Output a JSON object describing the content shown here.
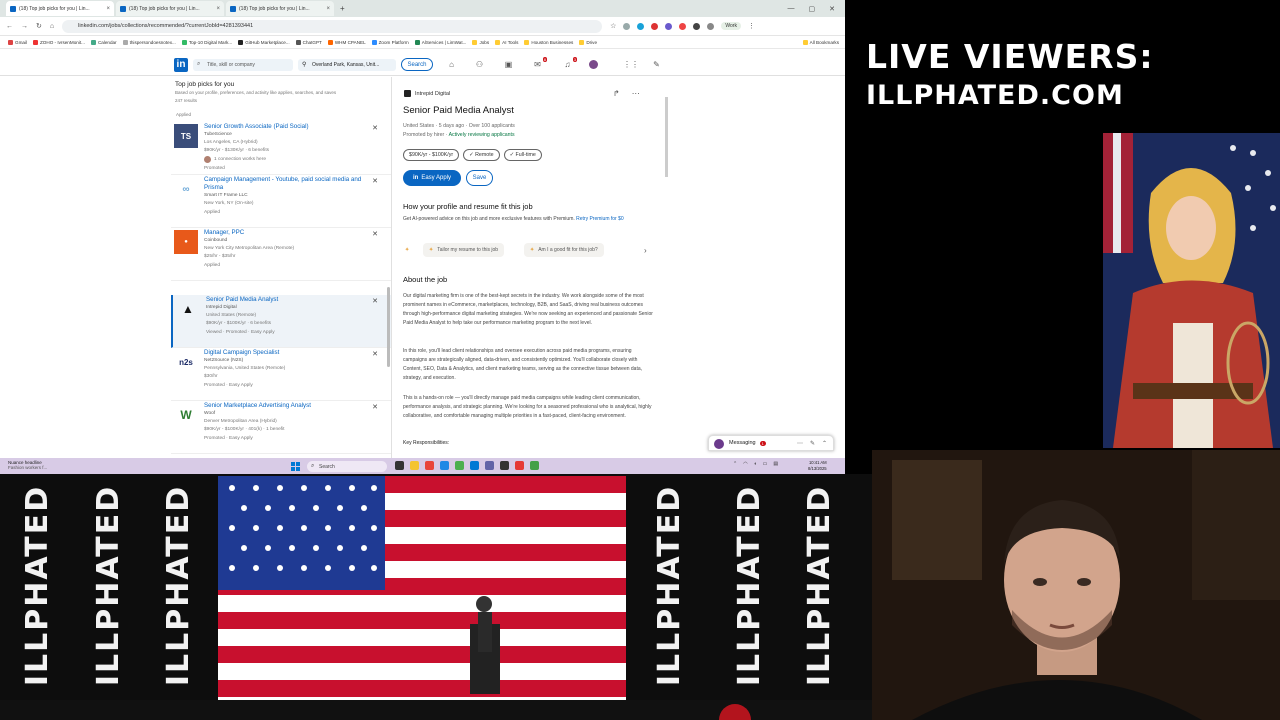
{
  "browser": {
    "tabs": [
      {
        "label": "(18) Top job picks for you | Lin..."
      },
      {
        "label": "(18) Top job picks for you | Lin..."
      },
      {
        "label": "(18) Top job picks for you | Lin..."
      }
    ],
    "url": "linkedin.com/jobs/collections/recommended/?currentJobId=4281393441",
    "profile_label": "Work",
    "bookmarks": [
      "Gmail",
      "ZOHO - IvrsenMonit...",
      "Calendar",
      "thispersondoesnotex...",
      "Top-10 Digital Mark...",
      "GitHub Marketplace...",
      "ChatGPT",
      "WHM CPANEL",
      "Zoom Platform",
      "AlServices | LimWat...",
      "Jobs",
      "AI Tools",
      "Houston Businesses",
      "Drive",
      "All Bookmarks"
    ]
  },
  "linkedin": {
    "search_placeholder": "Title, skill or company",
    "location_value": "Overland Park, Kansas, Unit...",
    "search_label": "Search",
    "nav_badges": [
      "",
      "8",
      "3",
      "2"
    ]
  },
  "job_list": {
    "title": "Top job picks for you",
    "subtitle": "Based on your profile, preferences, and activity like applies, searches, and saves",
    "count": "247 results",
    "top_status": "Applied",
    "cards": [
      {
        "logo": "TS",
        "logo_color": "#3a4d7a",
        "title": "Senior Growth Associate (Paid Social)",
        "company": "TubeScience",
        "location": "Los Angeles, CA (Hybrid)",
        "salary": "$90K/yr - $130K/yr · 6 benefits",
        "extra": "1 connection works here",
        "status": "Promoted"
      },
      {
        "logo": "∞",
        "logo_color": "#9ec6e6",
        "title": "Campaign Management - Youtube, paid social media and Prisma",
        "company": "Smart IT Frame LLC",
        "location": "New York, NY (On-site)",
        "salary": "",
        "extra": "",
        "status": "Applied"
      },
      {
        "logo": "●",
        "logo_color": "#e8591a",
        "title": "Manager, PPC",
        "company": "Coinbound",
        "location": "New York City Metropolitan Area (Remote)",
        "salary": "$25/hr - $35/hr",
        "extra": "",
        "status": "Applied"
      },
      {
        "logo": "▲",
        "logo_color": "#ffffff",
        "title": "Senior Paid Media Analyst",
        "company": "Intrepid Digital",
        "location": "United States (Remote)",
        "salary": "$90K/yr - $100K/yr · 6 benefits",
        "extra": "",
        "status": "Viewed · Promoted · Easy Apply"
      },
      {
        "logo": "n2s",
        "logo_color": "#ffffff",
        "title": "Digital Campaign Specialist",
        "company": "Net2Source (N2S)",
        "location": "Pennsylvania, United States (Remote)",
        "salary": "$30/hr",
        "extra": "",
        "status": "Promoted · Easy Apply"
      },
      {
        "logo": "W",
        "logo_color": "#ffffff",
        "title": "Senior Marketplace Advertising Analyst",
        "company": "Woof",
        "location": "Denver Metropolitan Area (Hybrid)",
        "salary": "$90K/yr - $100K/yr · 401(k) · 1 benefit",
        "extra": "",
        "status": "Promoted · Easy Apply"
      }
    ]
  },
  "detail": {
    "company": "Intrepid Digital",
    "title": "Senior Paid Media Analyst",
    "meta": "United States · 5 days ago · Over 100 applicants",
    "promoted": "Promoted by hirer · ",
    "actively": "Actively reviewing applicants",
    "pills": [
      "$90K/yr - $100K/yr",
      "✓ Remote",
      "✓ Full-time"
    ],
    "easy_apply": "Easy Apply",
    "save": "Save",
    "fit_heading": "How your profile and resume fit this job",
    "fit_text": "Get AI-powered advice on this job and more exclusive features with Premium. ",
    "fit_link": "Retry Premium for $0",
    "ai_chips": [
      "Tailor my resume to this job",
      "Am I a good fit for this job?"
    ],
    "about_heading": "About the job",
    "about_p1": "Our digital marketing firm is one of the best-kept secrets in the industry. We work alongside some of the most prominent names in eCommerce, marketplaces, technology, B2B, and SaaS, driving real business outcomes through high-performance digital marketing strategies. We're now seeking an experienced and passionate Senior Paid Media Analyst to help take our performance marketing program to the next level.",
    "about_p2": "In this role, you'll lead client relationships and oversee execution across paid media programs, ensuring campaigns are strategically aligned, data-driven, and consistently optimized. You'll collaborate closely with Content, SEO, Data & Analytics, and client marketing teams, serving as the connective tissue between data, strategy, and execution.",
    "about_p3": "This is a hands-on role — you'll directly manage paid media campaigns while leading client communication, performance analysis, and strategic planning. We're looking for a seasoned professional who is analytical, highly collaborative, and comfortable managing multiple priorities in a fast-paced, client-facing environment.",
    "key_resp": "Key Responsibilities:"
  },
  "messaging": {
    "label": "Messaging",
    "badge": "1"
  },
  "taskbar": {
    "weather_title": "Nuance headline",
    "weather_sub": "Fashion workers f...",
    "search_label": "Search",
    "time": "10:41 AM",
    "date": "8/13/2025"
  },
  "overlay": {
    "live_line1": "LIVE VIEWERS:",
    "live_line2": "ILLPHATED.COM",
    "stage_logo_text": "ILLPHATED"
  }
}
